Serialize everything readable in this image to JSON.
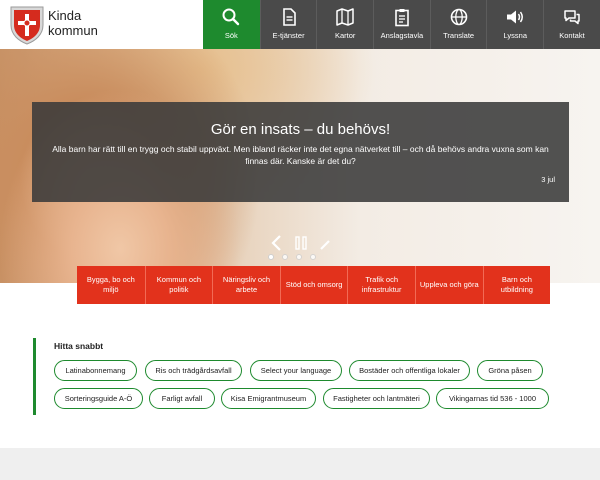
{
  "header": {
    "logo_line1": "Kinda",
    "logo_line2": "kommun",
    "nav": [
      {
        "label": "Sök",
        "icon": "search-icon"
      },
      {
        "label": "E-tjänster",
        "icon": "document-icon"
      },
      {
        "label": "Kartor",
        "icon": "map-icon"
      },
      {
        "label": "Anslagstavla",
        "icon": "clipboard-icon"
      },
      {
        "label": "Translate",
        "icon": "globe-icon"
      },
      {
        "label": "Lyssna",
        "icon": "speaker-icon"
      },
      {
        "label": "Kontakt",
        "icon": "chat-icon"
      }
    ]
  },
  "hero": {
    "title": "Gör en insats – du behövs!",
    "text": "Alla barn har rätt till en trygg och stabil uppväxt. Men ibland räcker inte det egna nätverket till – och då behövs andra vuxna som kan finnas där. Kanske är det du?",
    "date": "3 jul",
    "slide_count": 4,
    "active_slide": 1
  },
  "categories": [
    "Bygga, bo och miljö",
    "Kommun och politik",
    "Näringsliv och arbete",
    "Stöd och omsorg",
    "Trafik och infrastruktur",
    "Uppleva och göra",
    "Barn och utbildning"
  ],
  "quick": {
    "title": "Hitta snabbt",
    "links": [
      "Latinabonnemang",
      "Ris och trädgårdsavfall",
      "Select your language",
      "Bostäder och offentliga lokaler",
      "Gröna påsen",
      "Sorteringsguide A-Ö",
      "Farligt avfall",
      "Kisa Emigrantmuseum",
      "Fastigheter och lantmäteri",
      "Vikingarnas tid 536 - 1000"
    ]
  },
  "colors": {
    "nav_bg": "#4a4a4a",
    "nav_active": "#1e8a2e",
    "category_red": "#e2321c",
    "accent_green": "#1e8a2e"
  }
}
